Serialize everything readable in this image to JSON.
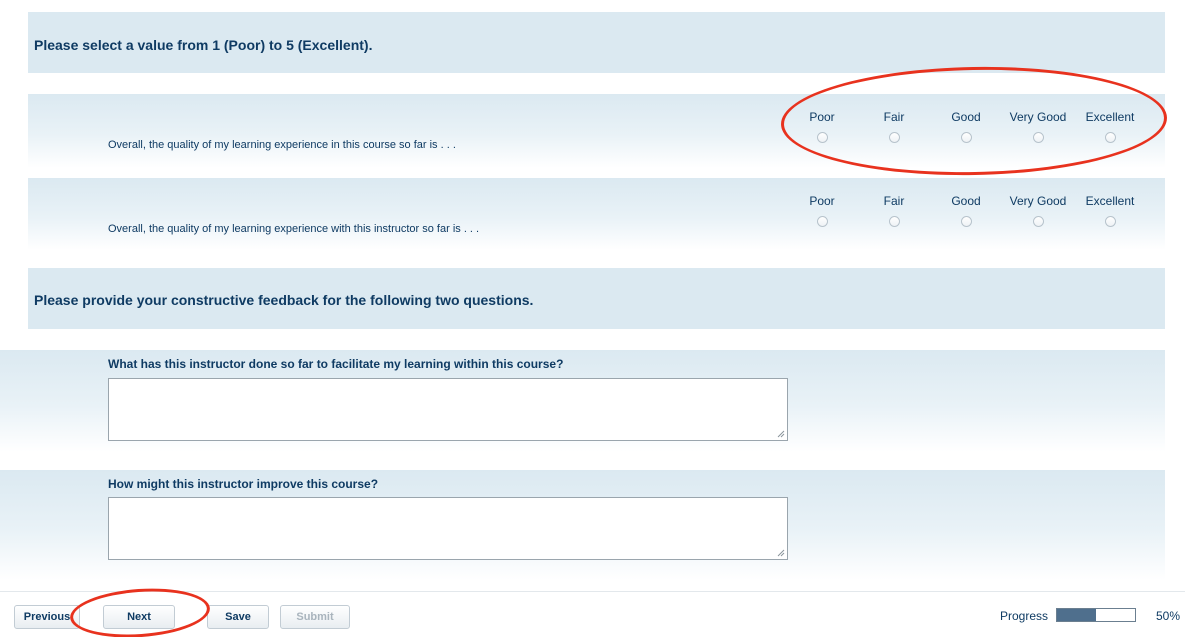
{
  "rating_section": {
    "title": "Please select a value from 1 (Poor) to 5 (Excellent).",
    "scale_labels": [
      "Poor",
      "Fair",
      "Good",
      "Very Good",
      "Excellent"
    ],
    "questions": [
      {
        "text": "Overall, the quality of my learning experience in this course so far is . . ."
      },
      {
        "text": "Overall, the quality of my learning experience with this instructor so far is . . ."
      }
    ]
  },
  "feedback_section": {
    "title": "Please provide your constructive feedback for the following two questions.",
    "questions": [
      {
        "label": "What has this instructor done so far to facilitate my learning within this course?",
        "value": ""
      },
      {
        "label": "How might this instructor improve this course?",
        "value": ""
      }
    ]
  },
  "footer": {
    "previous_label": "Previous",
    "next_label": "Next",
    "save_label": "Save",
    "submit_label": "Submit",
    "progress_label": "Progress",
    "progress_value": 0.5,
    "progress_text": "50%"
  },
  "colors": {
    "heading_text": "#0f3b63",
    "band_background": "#dbe9f1",
    "progress_fill": "#4f6f8d",
    "annotation": "#e8321e"
  }
}
